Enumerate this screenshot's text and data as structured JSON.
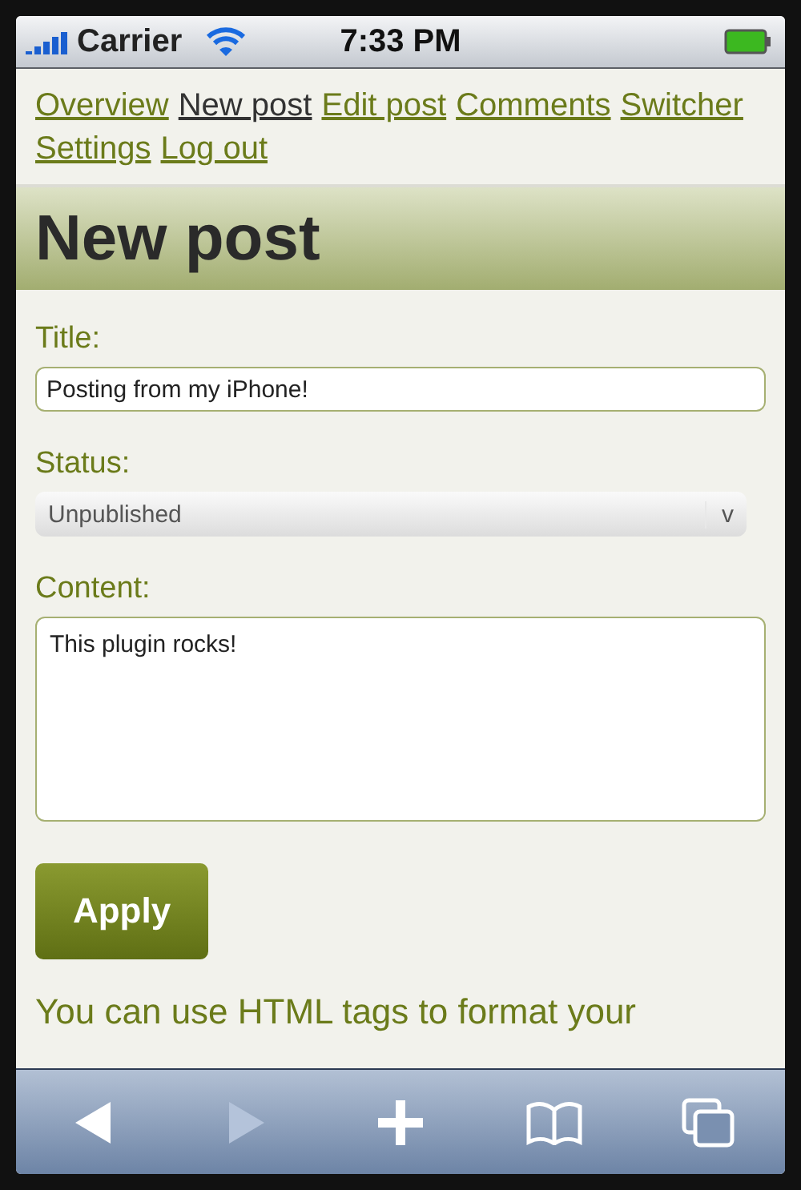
{
  "status_bar": {
    "carrier": "Carrier",
    "time": "7:33 PM"
  },
  "nav": [
    {
      "label": "Overview",
      "selected": false
    },
    {
      "label": "New post",
      "selected": true
    },
    {
      "label": "Edit post",
      "selected": false
    },
    {
      "label": "Comments",
      "selected": false
    },
    {
      "label": "Switcher",
      "selected": false
    },
    {
      "label": "Settings",
      "selected": false
    },
    {
      "label": "Log out",
      "selected": false
    }
  ],
  "heading": "New post",
  "form": {
    "title": {
      "label": "Title:",
      "value": "Posting from my iPhone!"
    },
    "status": {
      "label": "Status:",
      "value": "Unpublished",
      "arrow": "v"
    },
    "content": {
      "label": "Content:",
      "value": "This plugin rocks!"
    },
    "submit": "Apply"
  },
  "help": "You can use HTML tags to format your",
  "toolbar": [
    {
      "kind": "back",
      "disabled": false
    },
    {
      "kind": "forward",
      "disabled": true
    },
    {
      "kind": "add",
      "disabled": false
    },
    {
      "kind": "bookmarks",
      "disabled": false
    },
    {
      "kind": "pages",
      "disabled": false
    }
  ]
}
